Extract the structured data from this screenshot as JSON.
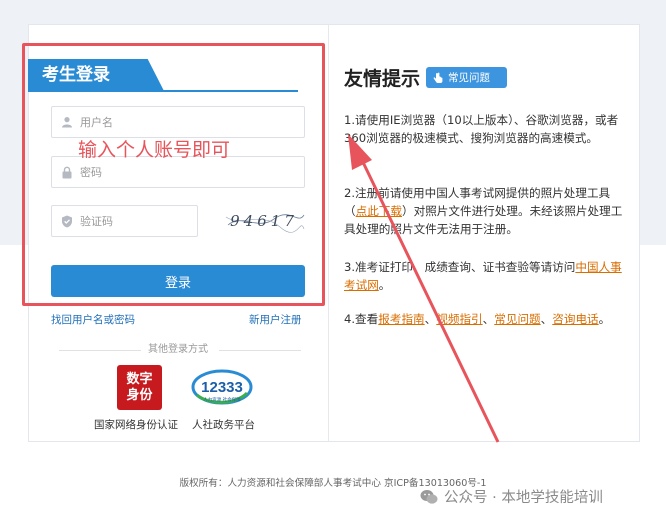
{
  "login": {
    "title": "考生登录",
    "username_placeholder": "用户名",
    "password_placeholder": "密码",
    "captcha_placeholder": "验证码",
    "captcha_text": "94617",
    "submit_label": "登录",
    "forgot_link": "找回用户名或密码",
    "register_link": "新用户注册",
    "other_login_label": "其他登录方式",
    "alt_methods": [
      {
        "logo_line1": "数字",
        "logo_line2": "身份",
        "label": "国家网络身份认证"
      },
      {
        "logo_text": "12333",
        "logo_sub": "人力资源 社会保障",
        "label": "人社政务平台"
      }
    ]
  },
  "annotation": {
    "text": "输入个人账号即可",
    "color": "#e8545b"
  },
  "tips": {
    "title": "友情提示",
    "faq_badge": "常见问题",
    "item1": "1.请使用IE浏览器（10以上版本）、谷歌浏览器，或者360浏览器的极速模式、搜狗浏览器的高速模式。",
    "item2_pre": "2.注册前请使用中国人事考试网提供的照片处理工具（",
    "item2_link": "点此下载",
    "item2_post": "）对照片文件进行处理。未经该照片处理工具处理的照片文件无法用于注册。",
    "item3_pre": "3.准考证打印、成绩查询、证书查验等请访问",
    "item3_link": "中国人事考试网",
    "item3_post": "。",
    "item4_pre": "4.查看",
    "item4_links": [
      "报考指南",
      "视频指引",
      "常见问题",
      "咨询电话"
    ],
    "item4_sep": "、",
    "item4_post": "。"
  },
  "footer": {
    "copyright": "版权所有：人力资源和社会保障部人事考试中心 京ICP备13013060号-1"
  },
  "watermark": {
    "text": "公众号 · 本地学技能培训"
  },
  "colors": {
    "brand_blue": "#2a8bd5",
    "link_orange": "#d96d00",
    "annotation_red": "#e8545b"
  }
}
